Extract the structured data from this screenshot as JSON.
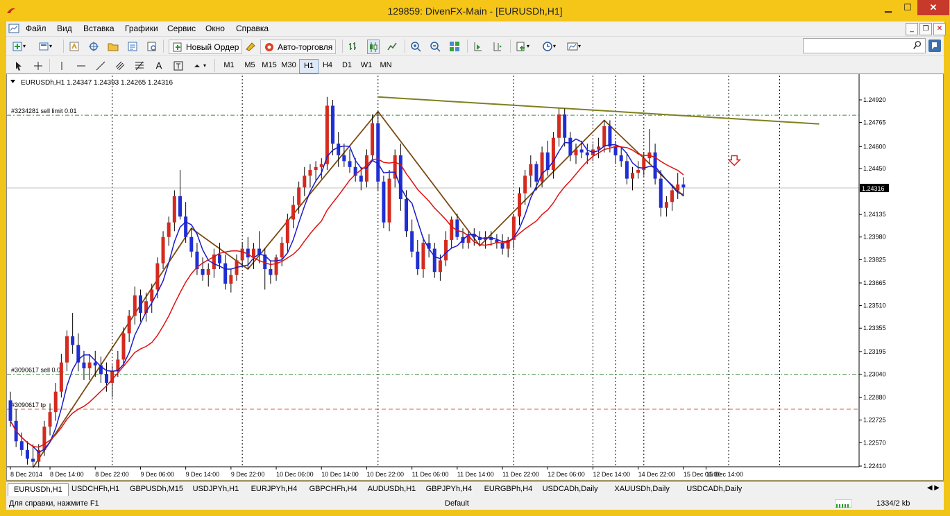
{
  "window": {
    "title": "129859: DivenFX-Main - [EURUSDh,H1]",
    "min": "▁",
    "max": "☐",
    "close": "✕"
  },
  "menu": [
    "Файл",
    "Вид",
    "Вставка",
    "Графики",
    "Сервис",
    "Окно",
    "Справка"
  ],
  "mdi": {
    "min": "_",
    "restore": "❐",
    "close": "✕"
  },
  "toolbar": {
    "new_order": "Новый Ордер",
    "auto_trading": "Авто-торговля",
    "search_icon": "search-icon",
    "help_icon": "help-icon"
  },
  "timeframes": [
    "M1",
    "M5",
    "M15",
    "M30",
    "H1",
    "H4",
    "D1",
    "W1",
    "MN"
  ],
  "active_timeframe": "H1",
  "chart": {
    "header": "EURUSDh,H1  1.24347 1.24393 1.24265 1.24316",
    "current_price": "1.24316",
    "order_lines": [
      {
        "label": "#3234281 sell limit 0.01",
        "price": 1.24815,
        "color": "#3a8a3a"
      },
      {
        "label": "#3090617 sell 0.01",
        "price": 1.2304,
        "color": "#3a8a3a"
      },
      {
        "label": "#3090617 tp",
        "price": 1.228,
        "color": "#d8603a"
      }
    ],
    "colors": {
      "bull": "#d42a1f",
      "bear": "#1f2fd4",
      "ma_fast": "#1a1acc",
      "ma_slow": "#e01010",
      "zigzag": "#7a4a10",
      "trendline": "#7f7f1f",
      "grid": "#000000"
    }
  },
  "chart_data": {
    "type": "candlestick",
    "symbol": "EURUSDh",
    "timeframe": "H1",
    "y_ticks": [
      "1.24920",
      "1.24765",
      "1.24600",
      "1.24450",
      "1.24135",
      "1.23980",
      "1.23825",
      "1.23665",
      "1.23510",
      "1.23355",
      "1.23195",
      "1.23040",
      "1.22880",
      "1.22725",
      "1.22570",
      "1.22410"
    ],
    "x_ticks": [
      "8 Dec 2014",
      "8 Dec 14:00",
      "8 Dec 22:00",
      "9 Dec 06:00",
      "9 Dec 14:00",
      "9 Dec 22:00",
      "10 Dec 06:00",
      "10 Dec 14:00",
      "10 Dec 22:00",
      "11 Dec 06:00",
      "11 Dec 14:00",
      "11 Dec 22:00",
      "12 Dec 06:00",
      "12 Dec 14:00",
      "14 Dec 22:00",
      "15 Dec 06:00",
      "15 Dec 14:00"
    ],
    "candles": [
      [
        1.2286,
        1.2292,
        1.2268,
        1.2272
      ],
      [
        1.2272,
        1.228,
        1.2254,
        1.2258
      ],
      [
        1.2258,
        1.2264,
        1.2248,
        1.2252
      ],
      [
        1.2252,
        1.2258,
        1.2242,
        1.2246
      ],
      [
        1.2246,
        1.2256,
        1.224,
        1.2244
      ],
      [
        1.2244,
        1.2256,
        1.224,
        1.2252
      ],
      [
        1.2252,
        1.2272,
        1.2248,
        1.2268
      ],
      [
        1.2268,
        1.2284,
        1.2262,
        1.2278
      ],
      [
        1.2278,
        1.2298,
        1.2272,
        1.2292
      ],
      [
        1.2292,
        1.2318,
        1.2288,
        1.2312
      ],
      [
        1.2312,
        1.2334,
        1.2306,
        1.233
      ],
      [
        1.233,
        1.2346,
        1.2318,
        1.2324
      ],
      [
        1.2324,
        1.2332,
        1.2306,
        1.2312
      ],
      [
        1.2312,
        1.232,
        1.23,
        1.2308
      ],
      [
        1.2308,
        1.2318,
        1.23,
        1.2312
      ],
      [
        1.2312,
        1.232,
        1.2302,
        1.231
      ],
      [
        1.231,
        1.2316,
        1.2298,
        1.2304
      ],
      [
        1.2304,
        1.2312,
        1.2292,
        1.2298
      ],
      [
        1.2298,
        1.231,
        1.2288,
        1.2306
      ],
      [
        1.2306,
        1.232,
        1.2302,
        1.2314
      ],
      [
        1.2314,
        1.2336,
        1.231,
        1.2332
      ],
      [
        1.2332,
        1.2348,
        1.2326,
        1.2344
      ],
      [
        1.2344,
        1.2364,
        1.2338,
        1.2358
      ],
      [
        1.2358,
        1.2362,
        1.234,
        1.2346
      ],
      [
        1.2346,
        1.236,
        1.234,
        1.2354
      ],
      [
        1.2354,
        1.2366,
        1.2346,
        1.2362
      ],
      [
        1.2362,
        1.2384,
        1.2356,
        1.238
      ],
      [
        1.238,
        1.2402,
        1.2376,
        1.2398
      ],
      [
        1.2398,
        1.2412,
        1.2392,
        1.2408
      ],
      [
        1.2408,
        1.243,
        1.2402,
        1.2426
      ],
      [
        1.2426,
        1.2444,
        1.241,
        1.2412
      ],
      [
        1.2412,
        1.2422,
        1.2394,
        1.2398
      ],
      [
        1.2398,
        1.2404,
        1.2384,
        1.2388
      ],
      [
        1.2388,
        1.2394,
        1.2372,
        1.2376
      ],
      [
        1.2376,
        1.2384,
        1.2368,
        1.2372
      ],
      [
        1.2372,
        1.238,
        1.2364,
        1.2376
      ],
      [
        1.2376,
        1.239,
        1.237,
        1.2386
      ],
      [
        1.2386,
        1.2394,
        1.2376,
        1.238
      ],
      [
        1.238,
        1.2386,
        1.2362,
        1.2366
      ],
      [
        1.2366,
        1.2376,
        1.236,
        1.2372
      ],
      [
        1.2372,
        1.2386,
        1.2368,
        1.2382
      ],
      [
        1.2382,
        1.2394,
        1.2378,
        1.239
      ],
      [
        1.239,
        1.2398,
        1.2376,
        1.2384
      ],
      [
        1.2384,
        1.2394,
        1.2376,
        1.239
      ],
      [
        1.239,
        1.2402,
        1.238,
        1.2386
      ],
      [
        1.2386,
        1.239,
        1.2362,
        1.2376
      ],
      [
        1.2376,
        1.2382,
        1.2366,
        1.2372
      ],
      [
        1.2372,
        1.2386,
        1.2368,
        1.2384
      ],
      [
        1.2384,
        1.2398,
        1.2378,
        1.2394
      ],
      [
        1.2394,
        1.2414,
        1.2388,
        1.241
      ],
      [
        1.241,
        1.2426,
        1.2404,
        1.242
      ],
      [
        1.242,
        1.2436,
        1.2414,
        1.2432
      ],
      [
        1.2432,
        1.2446,
        1.2426,
        1.244
      ],
      [
        1.244,
        1.2448,
        1.2432,
        1.2444
      ],
      [
        1.2444,
        1.245,
        1.2436,
        1.2446
      ],
      [
        1.2446,
        1.2452,
        1.2438,
        1.2448
      ],
      [
        1.2448,
        1.2494,
        1.2444,
        1.2488
      ],
      [
        1.2488,
        1.2492,
        1.2454,
        1.2462
      ],
      [
        1.2462,
        1.247,
        1.2446,
        1.2454
      ],
      [
        1.2454,
        1.2462,
        1.2446,
        1.245
      ],
      [
        1.245,
        1.2458,
        1.2442,
        1.2446
      ],
      [
        1.2446,
        1.2452,
        1.2436,
        1.244
      ],
      [
        1.244,
        1.2446,
        1.243,
        1.2436
      ],
      [
        1.2436,
        1.2458,
        1.2432,
        1.2454
      ],
      [
        1.2454,
        1.2482,
        1.245,
        1.2476
      ],
      [
        1.2476,
        1.2484,
        1.243,
        1.2436
      ],
      [
        1.2436,
        1.244,
        1.2404,
        1.2408
      ],
      [
        1.2408,
        1.2444,
        1.2402,
        1.2438
      ],
      [
        1.2438,
        1.2458,
        1.2432,
        1.2454
      ],
      [
        1.2454,
        1.2462,
        1.2416,
        1.2424
      ],
      [
        1.2424,
        1.243,
        1.2398,
        1.2402
      ],
      [
        1.2402,
        1.241,
        1.2384,
        1.2388
      ],
      [
        1.2388,
        1.2396,
        1.2372,
        1.2376
      ],
      [
        1.2376,
        1.2398,
        1.237,
        1.2394
      ],
      [
        1.2394,
        1.24,
        1.2384,
        1.239
      ],
      [
        1.239,
        1.2394,
        1.237,
        1.2374
      ],
      [
        1.2374,
        1.2386,
        1.2368,
        1.2382
      ],
      [
        1.2382,
        1.2402,
        1.2378,
        1.2396
      ],
      [
        1.2396,
        1.2412,
        1.239,
        1.241
      ],
      [
        1.241,
        1.2414,
        1.2396,
        1.2398
      ],
      [
        1.2398,
        1.2404,
        1.239,
        1.2394
      ],
      [
        1.2394,
        1.2402,
        1.239,
        1.24
      ],
      [
        1.24,
        1.2404,
        1.2392,
        1.2398
      ],
      [
        1.2398,
        1.2402,
        1.2392,
        1.2396
      ],
      [
        1.2396,
        1.2402,
        1.239,
        1.2398
      ],
      [
        1.2398,
        1.2402,
        1.2392,
        1.2396
      ],
      [
        1.2396,
        1.24,
        1.239,
        1.2394
      ],
      [
        1.2394,
        1.24,
        1.2386,
        1.239
      ],
      [
        1.239,
        1.2398,
        1.2384,
        1.2396
      ],
      [
        1.2396,
        1.2414,
        1.239,
        1.2412
      ],
      [
        1.2412,
        1.2432,
        1.2406,
        1.2428
      ],
      [
        1.2428,
        1.2444,
        1.242,
        1.244
      ],
      [
        1.244,
        1.2454,
        1.2432,
        1.2448
      ],
      [
        1.2448,
        1.245,
        1.243,
        1.2436
      ],
      [
        1.2436,
        1.246,
        1.2432,
        1.2456
      ],
      [
        1.2456,
        1.2464,
        1.244,
        1.2444
      ],
      [
        1.2444,
        1.247,
        1.2438,
        1.2466
      ],
      [
        1.2466,
        1.2486,
        1.246,
        1.2482
      ],
      [
        1.2482,
        1.2486,
        1.246,
        1.2466
      ],
      [
        1.2466,
        1.247,
        1.245,
        1.2454
      ],
      [
        1.2454,
        1.2462,
        1.2448,
        1.2458
      ],
      [
        1.2458,
        1.2464,
        1.2452,
        1.2456
      ],
      [
        1.2456,
        1.2462,
        1.2448,
        1.2454
      ],
      [
        1.2454,
        1.2462,
        1.245,
        1.2458
      ],
      [
        1.2458,
        1.2466,
        1.2452,
        1.246
      ],
      [
        1.246,
        1.2478,
        1.2456,
        1.2474
      ],
      [
        1.2474,
        1.2478,
        1.2456,
        1.246
      ],
      [
        1.246,
        1.2464,
        1.2448,
        1.2454
      ],
      [
        1.2454,
        1.246,
        1.2446,
        1.245
      ],
      [
        1.245,
        1.2456,
        1.2434,
        1.2438
      ],
      [
        1.2438,
        1.2446,
        1.243,
        1.2442
      ],
      [
        1.2442,
        1.245,
        1.2438,
        1.2444
      ],
      [
        1.2444,
        1.2456,
        1.244,
        1.2452
      ],
      [
        1.2452,
        1.2472,
        1.2448,
        1.2456
      ],
      [
        1.2456,
        1.2462,
        1.2434,
        1.2438
      ],
      [
        1.2438,
        1.2444,
        1.2412,
        1.2418
      ],
      [
        1.2418,
        1.2426,
        1.2412,
        1.2422
      ],
      [
        1.2422,
        1.2434,
        1.2416,
        1.243
      ],
      [
        1.243,
        1.2442,
        1.2424,
        1.2434
      ],
      [
        1.2434,
        1.2439,
        1.2426,
        1.2432
      ]
    ],
    "ma_fast": "moving average (blue)",
    "ma_slow": "moving average (red)"
  },
  "tabs": [
    "EURUSDh,H1",
    "USDCHFh,H1",
    "GBPUSDh,M15",
    "USDJPYh,H1",
    "EURJPYh,H4",
    "GBPCHFh,H4",
    "AUDUSDh,H1",
    "GBPJPYh,H4",
    "EURGBPh,H4",
    "USDCADh,Daily",
    "XAUUSDh,Daily",
    "USDCADh,Daily"
  ],
  "active_tab": "EURUSDh,H1",
  "status": {
    "help": "Для справки, нажмите F1",
    "profile": "Default",
    "traffic": "1334/2 kb"
  }
}
